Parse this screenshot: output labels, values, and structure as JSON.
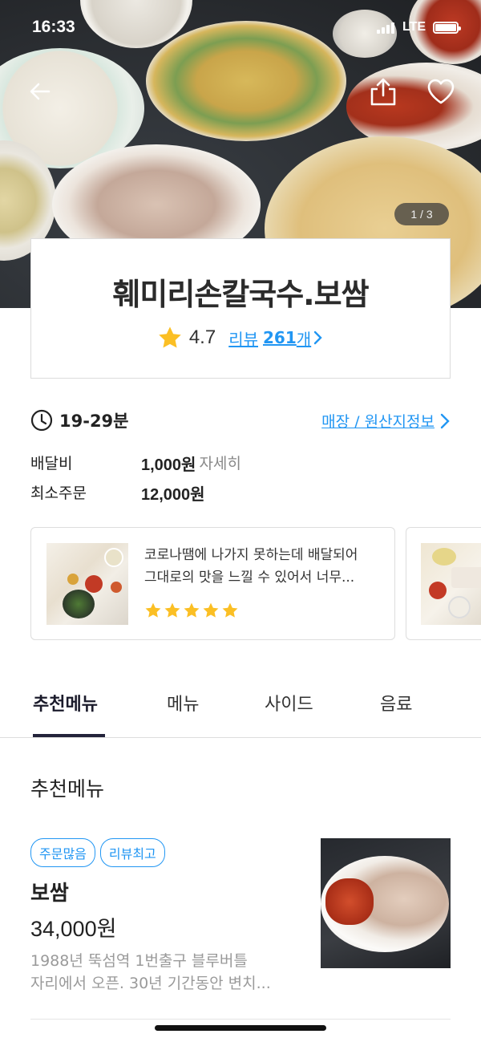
{
  "status_bar": {
    "time": "16:33",
    "network": "LTE"
  },
  "hero": {
    "image_counter": "1 / 3"
  },
  "store": {
    "name": "훼미리손칼국수.보쌈",
    "rating": "4.7",
    "review_prefix": "리뷰",
    "review_count": "261",
    "review_suffix": "개"
  },
  "delivery": {
    "time": "19-29분",
    "origin_link": "매장 / 원산지정보",
    "fee_label": "배달비",
    "fee_value": "1,000원",
    "fee_detail": "자세히",
    "min_order_label": "최소주문",
    "min_order_value": "12,000원"
  },
  "reviews": [
    {
      "text_line1": "코로나땜에 나가지 못하는데 배달되어",
      "text_line2": "그대로의 맛을 느낄 수 있어서 너무...",
      "stars": 5
    }
  ],
  "tabs": [
    {
      "label": "추천메뉴"
    },
    {
      "label": "메뉴"
    },
    {
      "label": "사이드"
    },
    {
      "label": "음료"
    }
  ],
  "section_title": "추천메뉴",
  "menu_item": {
    "badges": [
      "주문많음",
      "리뷰최고"
    ],
    "name": "보쌈",
    "price": "34,000원",
    "desc_line1": "1988년 뚝섬역 1번출구 블루버틀",
    "desc_line2": "자리에서 오픈. 30년 기간동안 변치..."
  },
  "colors": {
    "accent": "#2196f3",
    "star": "#fbbf24",
    "tab_underline": "#23233a"
  }
}
